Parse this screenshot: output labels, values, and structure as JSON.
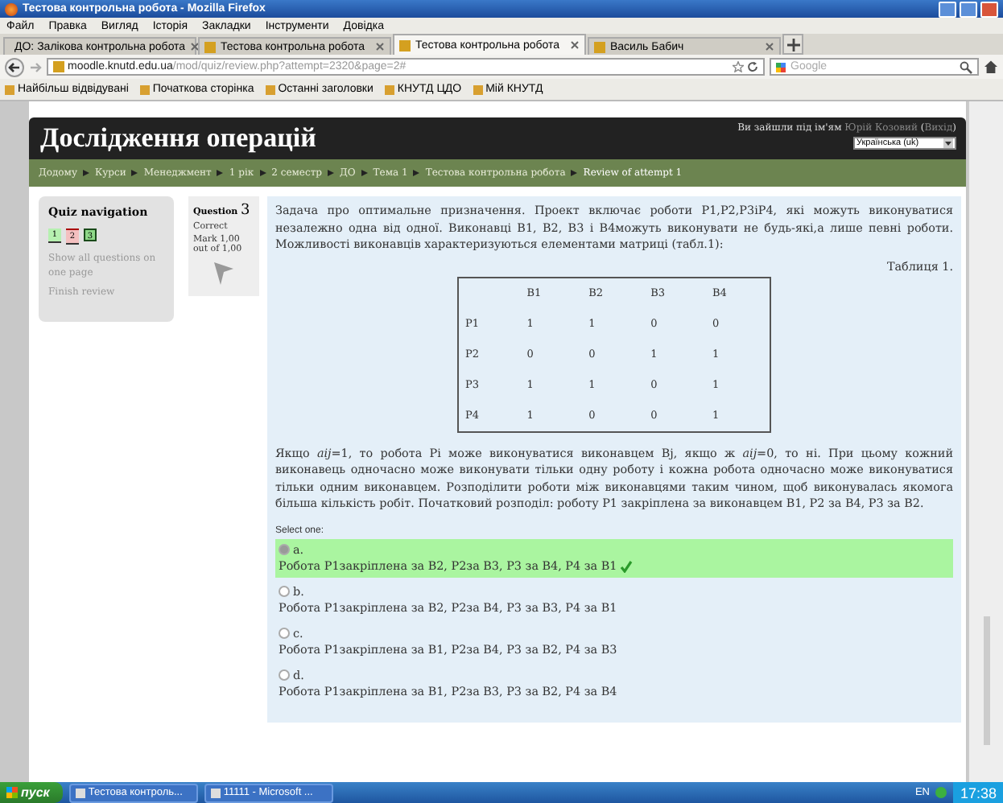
{
  "window": {
    "title": "Тестова контрольна робота - Mozilla Firefox"
  },
  "menu": [
    "Файл",
    "Правка",
    "Вигляд",
    "Історія",
    "Закладки",
    "Інструменти",
    "Довідка"
  ],
  "tabs": [
    {
      "label": "ДО: Залікова контрольна робота",
      "selected": false
    },
    {
      "label": "Тестова контрольна робота",
      "selected": false
    },
    {
      "label": "Тестова контрольна робота",
      "selected": true
    },
    {
      "label": "Василь Бабич",
      "selected": false
    }
  ],
  "address": {
    "host": "moodle.knutd.edu.ua",
    "path": "/mod/quiz/review.php?attempt=2320&page=2#"
  },
  "search": {
    "placeholder": "Google"
  },
  "bookmarks": [
    "Найбільш відвідувані",
    "Початкова сторінка",
    "Останні заголовки",
    "КНУТД ЦДО",
    "Мій КНУТД"
  ],
  "site": {
    "title": "Дослідження операцій",
    "login_prefix": "Ви зайшли під ім'ям",
    "user": "Юрій Козовий",
    "paren_open": "(",
    "logout": "Вихід",
    "paren_close": ")",
    "language": "Українська (uk)"
  },
  "breadcrumb": [
    "Додому",
    "Курси",
    "Менеджмент",
    "1 рік",
    "2 семестр",
    "ДО",
    "Тема 1",
    "Тестова контрольна робота",
    "Review of attempt 1"
  ],
  "quiz_nav": {
    "title": "Quiz navigation",
    "questions": [
      {
        "label": "1",
        "correct": true,
        "current": false
      },
      {
        "label": "2",
        "correct": false,
        "current": false
      },
      {
        "label": "3",
        "correct": true,
        "current": true
      }
    ],
    "links": [
      "Show all questions on one page",
      "Finish review"
    ]
  },
  "question_info": {
    "label": "Question",
    "number": "3",
    "state": "Correct",
    "mark": "Mark 1,00 out of 1,00"
  },
  "question": {
    "intro": "Задача про оптимальне призначення. Проект включає роботи P1,P2,P3іP4, які можуть виконуватися незалежно одна від одної. Виконавці B1, B2, B3 і B4можуть виконувати не будь-які,а лише певні роботи. Можливості виконавців характеризуються елементами матриці (табл.1):",
    "table_caption": "Таблиця 1.",
    "table": {
      "columns": [
        "",
        "B1",
        "B2",
        "B3",
        "B4"
      ],
      "rows": [
        [
          "P1",
          "1",
          "1",
          "0",
          "0"
        ],
        [
          "P2",
          "0",
          "0",
          "1",
          "1"
        ],
        [
          "P3",
          "1",
          "1",
          "0",
          "1"
        ],
        [
          "P4",
          "1",
          "0",
          "0",
          "1"
        ]
      ]
    },
    "body": "Якщо *aij*=1, то робота Pi може виконуватися виконавцем Bj, якщо ж *aij*=0, то ні. При цьому кожний виконавець одночасно може виконувати тільки одну роботу і кожна робота одночасно може виконуватися тільки одним виконавцем. Розподілити роботи між виконавцями таким чином, щоб виконувалась якомога більша кількість робіт. Початковий розподіл: роботу P1 закріплена за виконавцем B1, P2 за B4, P3 за B2.",
    "prompt": "Select one:",
    "options": [
      {
        "letter": "a.",
        "text": "Робота P1закріплена за B2, P2за B3, P3 за B4, P4 за B1",
        "selected": true,
        "correct": true
      },
      {
        "letter": "b.",
        "text": "Робота P1закріплена за B2, P2за B4, P3 за B3, P4 за B1",
        "selected": false,
        "correct": false
      },
      {
        "letter": "c.",
        "text": "Робота P1закріплена за B1, P2за B4, P3 за B2, P4 за B3",
        "selected": false,
        "correct": false
      },
      {
        "letter": "d.",
        "text": "Робота P1закріплена за B1, P2за B3, P3 за B2, P4 за B4",
        "selected": false,
        "correct": false
      }
    ]
  },
  "taskbar": {
    "start": "пуск",
    "tasks": [
      "Тестова контроль...",
      "11111 - Microsoft ..."
    ],
    "language": "EN",
    "clock": "17:38"
  }
}
